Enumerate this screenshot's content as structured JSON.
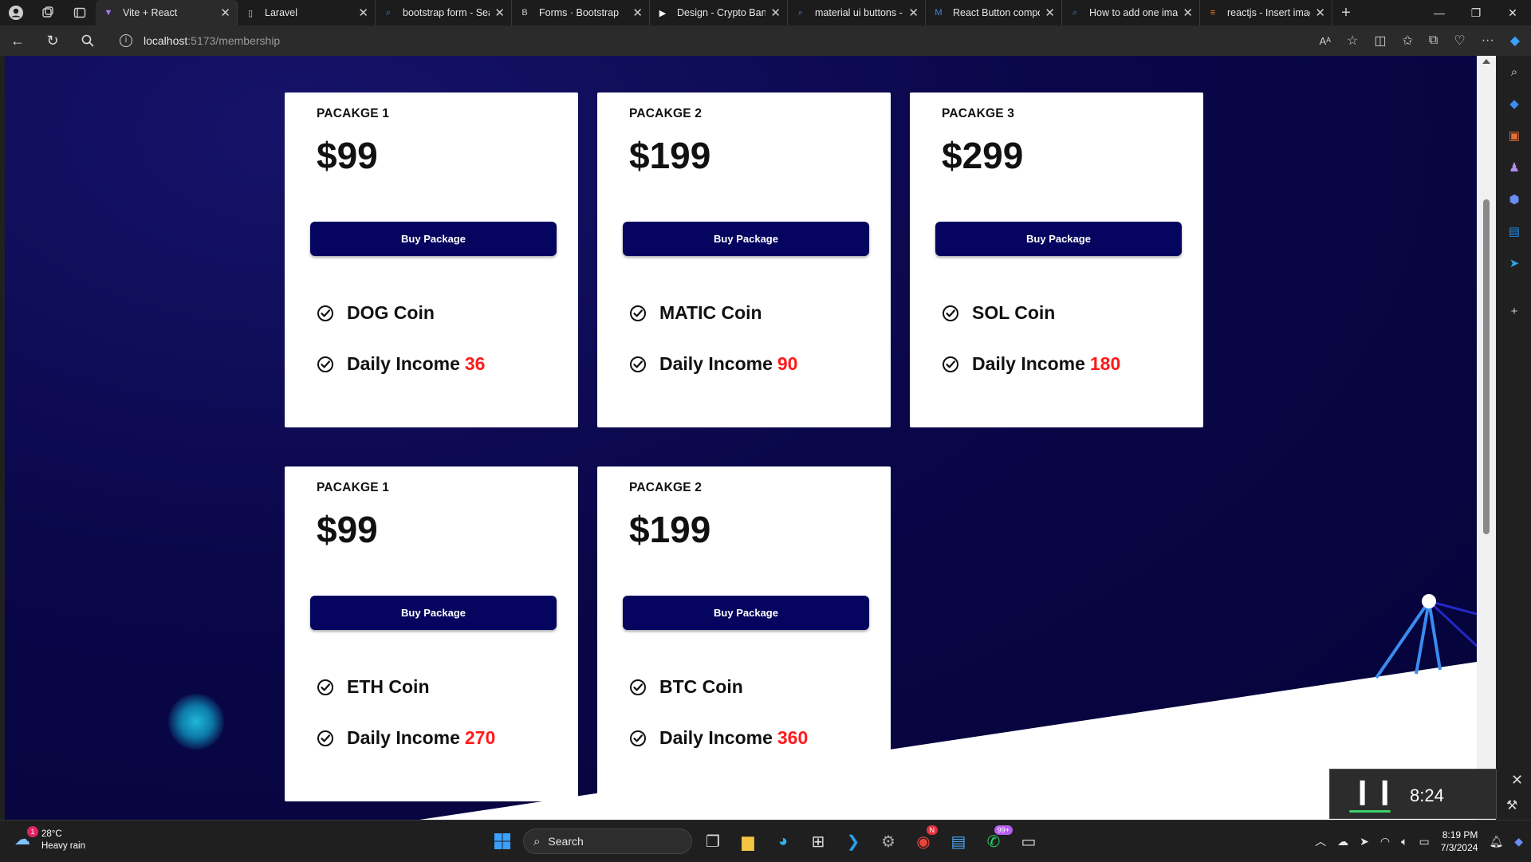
{
  "browser": {
    "tabs": [
      {
        "title": "Vite + React",
        "active": true,
        "icon": "vite-icon"
      },
      {
        "title": "Laravel",
        "active": false,
        "icon": "page-icon"
      },
      {
        "title": "bootstrap form - Sea",
        "active": false,
        "icon": "search-icon"
      },
      {
        "title": "Forms · Bootstrap",
        "active": false,
        "icon": "bootstrap-icon"
      },
      {
        "title": "Design - Crypto Banl",
        "active": false,
        "icon": "figma-icon"
      },
      {
        "title": "material ui buttons -",
        "active": false,
        "icon": "search-icon"
      },
      {
        "title": "React Button compo",
        "active": false,
        "icon": "mui-icon"
      },
      {
        "title": "How to add one ima",
        "active": false,
        "icon": "search-icon"
      },
      {
        "title": "reactjs - Insert image",
        "active": false,
        "icon": "stackoverflow-icon"
      }
    ],
    "url_host": "localhost",
    "url_path": ":5173/membership"
  },
  "packages": [
    {
      "name": "PACAKGE 1",
      "price": "$99",
      "button": "Buy Package",
      "coin": "DOG Coin",
      "income_label": "Daily Income",
      "income_value": "36"
    },
    {
      "name": "PACAKGE 2",
      "price": "$199",
      "button": "Buy Package",
      "coin": "MATIC Coin",
      "income_label": "Daily Income",
      "income_value": "90"
    },
    {
      "name": "PACAKGE 3",
      "price": "$299",
      "button": "Buy Package",
      "coin": "SOL Coin",
      "income_label": "Daily Income",
      "income_value": "180"
    },
    {
      "name": "PACAKGE 1",
      "price": "$99",
      "button": "Buy Package",
      "coin": "ETH Coin",
      "income_label": "Daily Income",
      "income_value": "270"
    },
    {
      "name": "PACAKGE 2",
      "price": "$199",
      "button": "Buy Package",
      "coin": "BTC Coin",
      "income_label": "Daily Income",
      "income_value": "360"
    }
  ],
  "media": {
    "time": "8:24"
  },
  "taskbar": {
    "weather_temp": "28°C",
    "weather_desc": "Heavy rain",
    "weather_badge": "1",
    "search_label": "Search",
    "whatsapp_badge": "99+",
    "chrome_badge": "N",
    "time": "8:19 PM",
    "date": "7/3/2024"
  },
  "colors": {
    "accent_button": "#050560",
    "income_red": "#ff1a1a",
    "page_bg": "#0a074a"
  }
}
